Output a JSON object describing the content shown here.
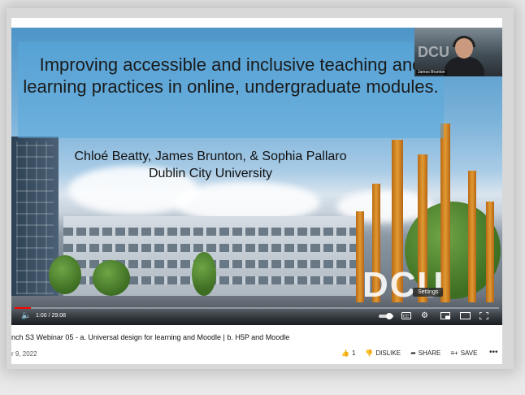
{
  "player": {
    "slide_title": "Improving accessible and inclusive teaching and learning practices in online, undergraduate modules.",
    "authors_line1": "Chloé Beatty, James Brunton, & Sophia Pallaro",
    "authors_line2": "Dublin City University",
    "logo_text": "DCU",
    "cam_label": "James Brunton",
    "cam_logo": "DCU",
    "settings_tooltip": "Settings",
    "time": "1:00 / 29:08",
    "progress_fraction": 0.034
  },
  "video": {
    "title": "nch S3 Webinar 05 - a. Universal design for learning and Moodle | b. H5P and Moodle",
    "date": "r 9, 2022"
  },
  "actions": {
    "like_count": "1",
    "dislike_label": "DISLIKE",
    "share_label": "SHARE",
    "save_label": "SAVE"
  },
  "icons": {
    "volume": "volume-icon",
    "play": "play-toggle-icon",
    "cc": "captions-icon",
    "settings": "gear-icon",
    "miniplayer": "miniplayer-icon",
    "theater": "theater-icon",
    "fullscreen": "fullscreen-icon"
  },
  "colors": {
    "progress": "#ff0000"
  }
}
